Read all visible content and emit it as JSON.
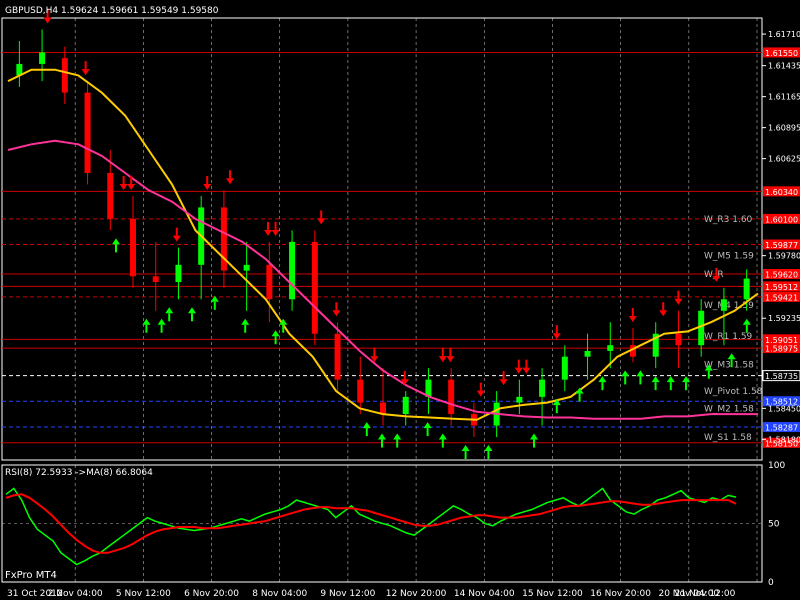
{
  "window": {
    "header": "GBPUSD,H4  1.59624 1.59661 1.59549 1.59580",
    "footer_label": "FxPro MT4"
  },
  "colors": {
    "background": "#000000",
    "frame": "#ffffff",
    "grid": "#ffffff",
    "bull_candle": "#00ff00",
    "bear_candle": "#ff0000",
    "fast_ma": "#ffcc00",
    "slow_ma": "#ff3399",
    "buy_arrow": "#00ff00",
    "sell_arrow": "#ff0000",
    "level_line": "#cc0000",
    "pivot_line": "#ffffff",
    "m2_line": "#2244ff",
    "rsi_line": "#00ff00",
    "rsi_ma_line": "#ff0000"
  },
  "chart_data": [
    {
      "type": "candlestick",
      "title": "GBPUSD,H4",
      "quote": {
        "open": 1.59624,
        "high": 1.59661,
        "low": 1.59549,
        "close": 1.5958
      },
      "ylim": [
        1.58,
        1.6185
      ],
      "y_ticks": [
        "1.61710",
        "1.61435",
        "1.61165",
        "1.60895",
        "1.60625",
        "1.59780",
        "1.59235",
        "1.58450",
        "1.58180"
      ],
      "x_ticks": [
        "31 Oct 2012",
        "2 Nov 04:00",
        "5 Nov 12:00",
        "6 Nov 20:00",
        "8 Nov 04:00",
        "9 Nov 12:00",
        "12 Nov 20:00",
        "14 Nov 04:00",
        "15 Nov 12:00",
        "16 Nov 20:00",
        "20 Nov 04:00",
        "21 Nov 12:00"
      ],
      "grid": "vertical dashed at day starts",
      "series": [
        {
          "name": "",
          "kind": "fast_ma",
          "values": [
            1.613,
            1.614,
            1.614,
            1.6135,
            1.612,
            1.61,
            1.607,
            1.604,
            1.6,
            1.598,
            1.596,
            1.594,
            1.591,
            1.589,
            1.586,
            1.5845,
            1.584,
            1.5838,
            1.5837,
            1.5836,
            1.5835,
            1.5845,
            1.5848,
            1.585,
            1.5855,
            1.587,
            1.589,
            1.59,
            1.591,
            1.5912,
            1.592,
            1.593,
            1.5945
          ]
        },
        {
          "name": "",
          "kind": "slow_ma",
          "values": [
            1.607,
            1.6075,
            1.6078,
            1.6075,
            1.6065,
            1.605,
            1.6035,
            1.6025,
            1.601,
            1.6,
            1.599,
            1.5975,
            1.5955,
            1.5935,
            1.5915,
            1.5895,
            1.5878,
            1.5865,
            1.5855,
            1.5848,
            1.5842,
            1.584,
            1.5838,
            1.5837,
            1.5837,
            1.5836,
            1.5836,
            1.5836,
            1.5838,
            1.5838,
            1.584,
            1.584,
            1.584
          ]
        }
      ],
      "candles": [
        {
          "o": 1.6135,
          "h": 1.6165,
          "l": 1.6125,
          "c": 1.6145
        },
        {
          "o": 1.6145,
          "h": 1.6175,
          "l": 1.613,
          "c": 1.6155
        },
        {
          "o": 1.615,
          "h": 1.616,
          "l": 1.611,
          "c": 1.612
        },
        {
          "o": 1.612,
          "h": 1.613,
          "l": 1.604,
          "c": 1.605
        },
        {
          "o": 1.605,
          "h": 1.607,
          "l": 1.6,
          "c": 1.601
        },
        {
          "o": 1.601,
          "h": 1.603,
          "l": 1.595,
          "c": 1.596
        },
        {
          "o": 1.596,
          "h": 1.599,
          "l": 1.593,
          "c": 1.5955
        },
        {
          "o": 1.5955,
          "h": 1.5985,
          "l": 1.594,
          "c": 1.597
        },
        {
          "o": 1.597,
          "h": 1.603,
          "l": 1.594,
          "c": 1.602
        },
        {
          "o": 1.602,
          "h": 1.6035,
          "l": 1.595,
          "c": 1.5965
        },
        {
          "o": 1.5965,
          "h": 1.599,
          "l": 1.593,
          "c": 1.597
        },
        {
          "o": 1.597,
          "h": 1.599,
          "l": 1.592,
          "c": 1.594
        },
        {
          "o": 1.594,
          "h": 1.6,
          "l": 1.593,
          "c": 1.599
        },
        {
          "o": 1.599,
          "h": 1.6,
          "l": 1.59,
          "c": 1.591
        },
        {
          "o": 1.591,
          "h": 1.592,
          "l": 1.586,
          "c": 1.587
        },
        {
          "o": 1.587,
          "h": 1.589,
          "l": 1.584,
          "c": 1.585
        },
        {
          "o": 1.585,
          "h": 1.588,
          "l": 1.583,
          "c": 1.584
        },
        {
          "o": 1.584,
          "h": 1.586,
          "l": 1.583,
          "c": 1.5855
        },
        {
          "o": 1.5855,
          "h": 1.588,
          "l": 1.584,
          "c": 1.587
        },
        {
          "o": 1.587,
          "h": 1.588,
          "l": 1.583,
          "c": 1.584
        },
        {
          "o": 1.584,
          "h": 1.585,
          "l": 1.582,
          "c": 1.583
        },
        {
          "o": 1.583,
          "h": 1.586,
          "l": 1.582,
          "c": 1.585
        },
        {
          "o": 1.585,
          "h": 1.587,
          "l": 1.584,
          "c": 1.5855
        },
        {
          "o": 1.5855,
          "h": 1.588,
          "l": 1.583,
          "c": 1.587
        },
        {
          "o": 1.587,
          "h": 1.59,
          "l": 1.586,
          "c": 1.589
        },
        {
          "o": 1.589,
          "h": 1.591,
          "l": 1.587,
          "c": 1.5895
        },
        {
          "o": 1.5895,
          "h": 1.592,
          "l": 1.588,
          "c": 1.59
        },
        {
          "o": 1.59,
          "h": 1.5915,
          "l": 1.5885,
          "c": 1.589
        },
        {
          "o": 1.589,
          "h": 1.592,
          "l": 1.588,
          "c": 1.591
        },
        {
          "o": 1.591,
          "h": 1.593,
          "l": 1.588,
          "c": 1.59
        },
        {
          "o": 1.59,
          "h": 1.594,
          "l": 1.589,
          "c": 1.593
        },
        {
          "o": 1.593,
          "h": 1.595,
          "l": 1.59,
          "c": 1.594
        },
        {
          "o": 1.594,
          "h": 1.5966,
          "l": 1.593,
          "c": 1.5958
        }
      ],
      "levels": [
        {
          "label": "1.61550",
          "style": "solid",
          "kind": "red"
        },
        {
          "label": "1.60340",
          "style": "solid",
          "kind": "red"
        },
        {
          "label": "1.60100",
          "style": "dashed",
          "kind": "red"
        },
        {
          "label": "1.59877",
          "style": "dashed",
          "kind": "red"
        },
        {
          "label": "1.59620",
          "style": "solid",
          "kind": "red"
        },
        {
          "label": "1.59512",
          "style": "solid",
          "kind": "red"
        },
        {
          "label": "1.59421",
          "style": "dashed",
          "kind": "red"
        },
        {
          "label": "1.59051",
          "style": "solid",
          "kind": "red"
        },
        {
          "label": "1.58975",
          "style": "solid",
          "kind": "red"
        },
        {
          "label": "1.58735",
          "style": "dashed",
          "kind": "pivot"
        },
        {
          "label": "1.58512",
          "style": "dashed",
          "kind": "m2"
        },
        {
          "label": "1.58287",
          "style": "dashed",
          "kind": "m2"
        },
        {
          "label": "1.58150",
          "style": "solid",
          "kind": "red"
        }
      ],
      "level_names": [
        "W_R3 1.60",
        "W_M5 1.59",
        "W_R",
        "W_M4 1.59",
        "W_R1 1.59",
        "W_M3 1.58",
        "W_Pivot 1.58",
        "W_M2 1.58",
        "W_S1 1.58"
      ]
    },
    {
      "type": "line",
      "title": "RSI(8) 72.5933  ->MA(8) 66.8064",
      "ylim": [
        0,
        100
      ],
      "y_ticks": [
        "100",
        "50",
        "0"
      ],
      "series": [
        {
          "name": "RSI(8)",
          "values": [
            75,
            80,
            70,
            55,
            45,
            40,
            35,
            25,
            20,
            15,
            18,
            22,
            25,
            30,
            35,
            40,
            45,
            50,
            55,
            52,
            50,
            48,
            46,
            45,
            44,
            45,
            46,
            48,
            50,
            52,
            54,
            52,
            55,
            58,
            60,
            62,
            65,
            70,
            68,
            66,
            64,
            62,
            55,
            60,
            65,
            58,
            55,
            52,
            50,
            48,
            45,
            42,
            40,
            45,
            50,
            55,
            60,
            65,
            62,
            58,
            55,
            50,
            48,
            52,
            55,
            58,
            60,
            62,
            65,
            68,
            70,
            72,
            68,
            65,
            70,
            75,
            80,
            70,
            65,
            60,
            58,
            62,
            65,
            70,
            72,
            75,
            78,
            72,
            70,
            68,
            72,
            70,
            74,
            72.59
          ]
        },
        {
          "name": "MA(8)",
          "values": [
            72,
            74,
            75,
            72,
            67,
            62,
            56,
            49,
            42,
            36,
            31,
            27,
            25,
            25,
            27,
            29,
            32,
            36,
            40,
            43,
            45,
            46,
            47,
            47,
            47,
            46,
            46,
            46,
            47,
            48,
            49,
            50,
            51,
            52,
            54,
            56,
            58,
            60,
            62,
            63,
            64,
            64,
            63,
            63,
            63,
            62,
            61,
            59,
            57,
            55,
            53,
            51,
            49,
            48,
            48,
            49,
            51,
            53,
            55,
            56,
            57,
            57,
            56,
            55,
            55,
            55,
            56,
            57,
            58,
            60,
            62,
            64,
            65,
            65,
            66,
            67,
            68,
            69,
            69,
            68,
            67,
            66,
            66,
            67,
            68,
            69,
            70,
            70,
            70,
            70,
            70,
            70,
            70,
            66.81
          ]
        }
      ]
    }
  ],
  "signals": {
    "sell_x": [
      0.06,
      0.11,
      0.16,
      0.17,
      0.23,
      0.27,
      0.3,
      0.35,
      0.36,
      0.42,
      0.44,
      0.49,
      0.53,
      0.58,
      0.59,
      0.63,
      0.66,
      0.68,
      0.69,
      0.73,
      0.83,
      0.87,
      0.89,
      0.94
    ],
    "buy_x": [
      0.15,
      0.19,
      0.21,
      0.22,
      0.25,
      0.28,
      0.32,
      0.36,
      0.37,
      0.48,
      0.5,
      0.52,
      0.56,
      0.58,
      0.61,
      0.64,
      0.7,
      0.73,
      0.76,
      0.79,
      0.82,
      0.84,
      0.86,
      0.88,
      0.9,
      0.93,
      0.96,
      0.98
    ]
  }
}
